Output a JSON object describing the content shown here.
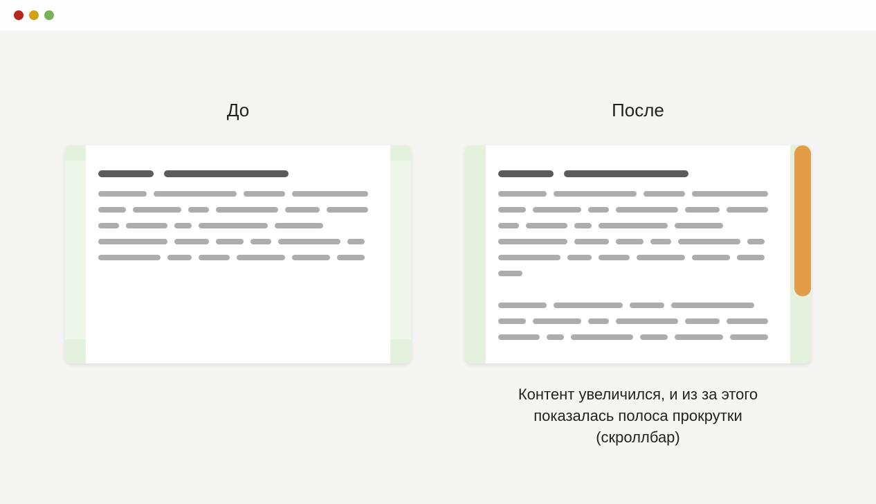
{
  "before": {
    "heading": "До"
  },
  "after": {
    "heading": "После",
    "caption_l1": "Контент увеличился, и из за этого",
    "caption_l2": "показалась полоса прокрутки",
    "caption_l3": "(скроллбар)"
  },
  "colors": {
    "panel_bg": "#e4f1dd",
    "scrollbar": "#e39c48",
    "dark_bar": "#5c5c5c",
    "grey_bar": "#adadad"
  }
}
